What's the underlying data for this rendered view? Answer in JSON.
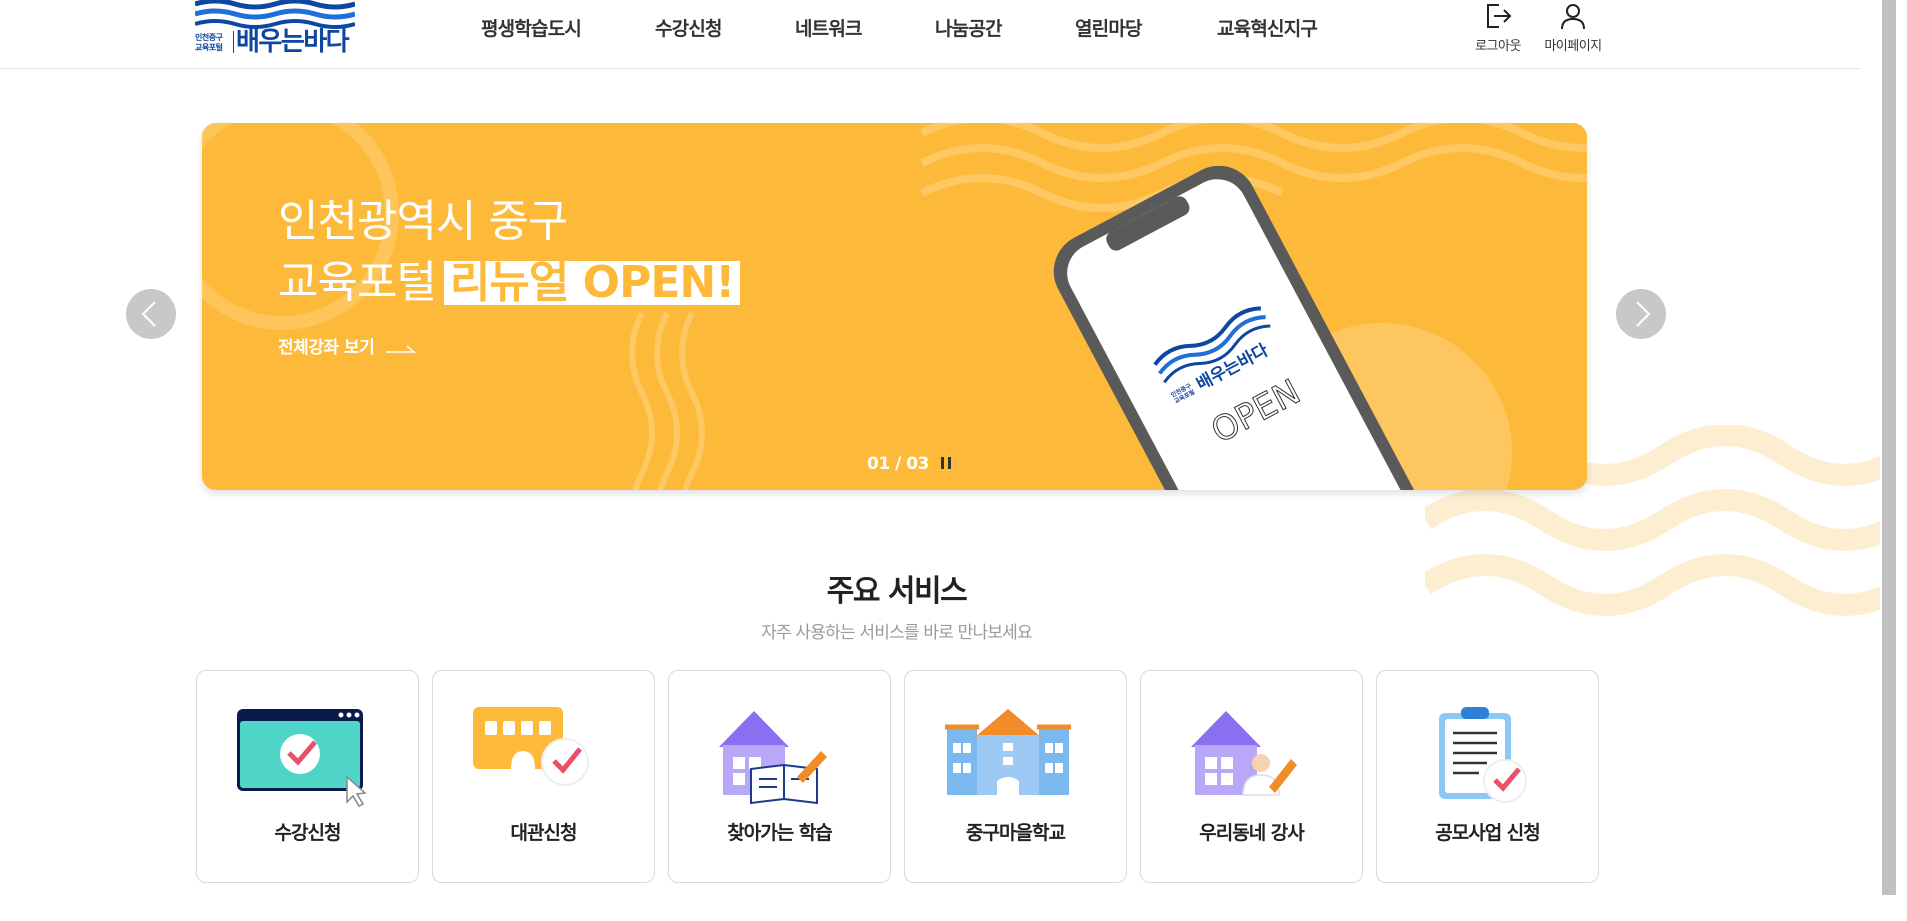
{
  "logo": {
    "small_line1": "인천중구",
    "small_line2": "교육포털",
    "name": "배우는바다"
  },
  "nav": [
    "평생학습도시",
    "수강신청",
    "네트워크",
    "나눔공간",
    "열린마당",
    "교육혁신지구"
  ],
  "utility": {
    "logout": "로그아웃",
    "mypage": "마이페이지"
  },
  "banner": {
    "line1": "인천광역시 중구",
    "line2_prefix": "교육포털",
    "line2_highlight": "리뉴얼 OPEN!",
    "link": "전체강좌 보기",
    "counter": "01 / 03",
    "phone_logo_small1": "인천중구",
    "phone_logo_small2": "교육포털",
    "phone_logo_name": "배우는바다",
    "phone_text": "OPEN",
    "background_color": "#fdb93a"
  },
  "services": {
    "title": "주요 서비스",
    "subtitle": "자주 사용하는 서비스를 바로 만나보세요",
    "items": [
      {
        "label": "수강신청",
        "icon": "browser-check-icon"
      },
      {
        "label": "대관신청",
        "icon": "building-check-icon"
      },
      {
        "label": "찾아가는 학습",
        "icon": "house-book-icon"
      },
      {
        "label": "중구마을학교",
        "icon": "school-icon"
      },
      {
        "label": "우리동네 강사",
        "icon": "house-teacher-icon"
      },
      {
        "label": "공모사업 신청",
        "icon": "clipboard-check-icon"
      }
    ]
  },
  "colors": {
    "brand_blue": "#0d47a1",
    "banner_yellow": "#fdb93a",
    "accent_pink": "#e8506b"
  }
}
